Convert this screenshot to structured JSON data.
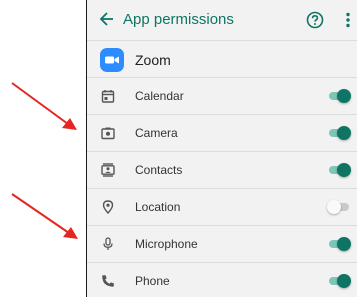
{
  "appbar": {
    "back_icon": "arrow-back-icon",
    "title": "App permissions",
    "help_icon": "help-circle-icon",
    "more_icon": "more-vert-icon"
  },
  "app": {
    "name": "Zoom",
    "icon": "zoom-camera-logo-icon"
  },
  "permissions": [
    {
      "label": "Calendar",
      "icon": "calendar-icon",
      "enabled": true
    },
    {
      "label": "Camera",
      "icon": "camera-icon",
      "enabled": true
    },
    {
      "label": "Contacts",
      "icon": "contacts-icon",
      "enabled": true
    },
    {
      "label": "Location",
      "icon": "location-pin-icon",
      "enabled": false
    },
    {
      "label": "Microphone",
      "icon": "microphone-icon",
      "enabled": true
    },
    {
      "label": "Phone",
      "icon": "phone-icon",
      "enabled": true
    }
  ],
  "annotations": {
    "arrow_color": "#e52620",
    "arrows_point_to": [
      "Camera",
      "Microphone"
    ]
  },
  "colors": {
    "accent": "#0e7565",
    "toggle_track_on": "#7cc7b8",
    "zoom_brand": "#2d8cff"
  }
}
